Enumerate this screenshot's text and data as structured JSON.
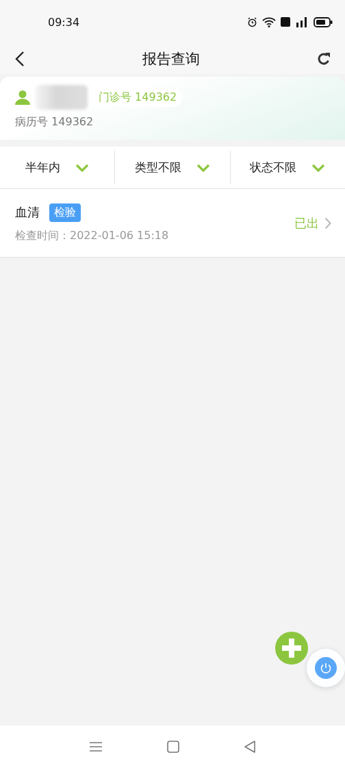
{
  "status_bar": {
    "time": "09:34"
  },
  "header": {
    "title": "报告查询"
  },
  "patient": {
    "outpatient_no": "门诊号 149362",
    "record_no": "病历号 149362"
  },
  "filters": [
    {
      "label": "半年内"
    },
    {
      "label": "类型不限"
    },
    {
      "label": "状态不限"
    }
  ],
  "reports": [
    {
      "name": "血清",
      "tag": "检验",
      "time": "检查时间：2022-01-06 15:18",
      "status": "已出"
    }
  ]
}
